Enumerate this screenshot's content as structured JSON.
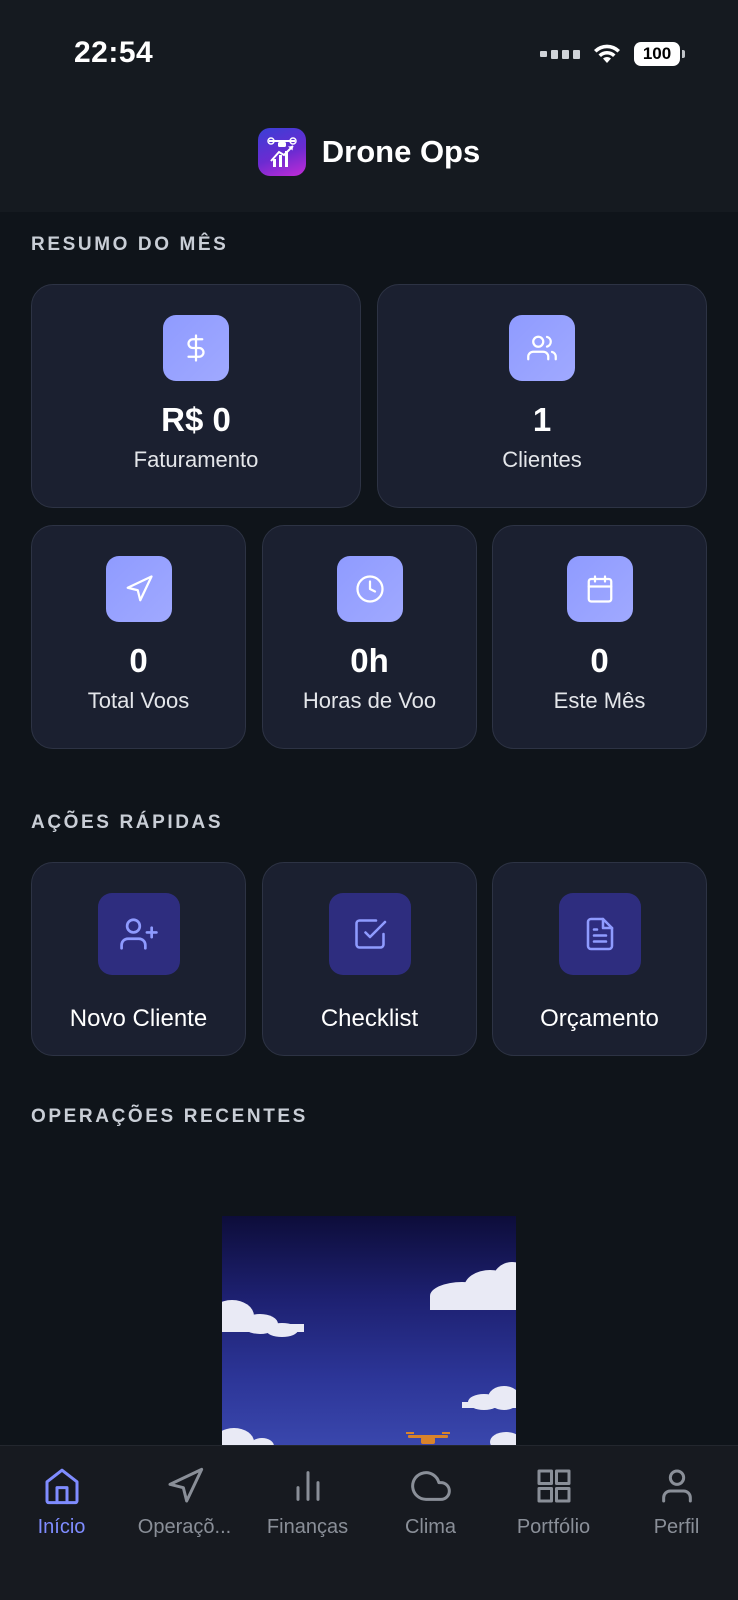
{
  "status_bar": {
    "time": "22:54",
    "battery": "100"
  },
  "header": {
    "app_title": "Drone Ops"
  },
  "summary": {
    "title": "RESUMO DO MÊS",
    "stats": [
      {
        "value": "R$ 0",
        "label": "Faturamento",
        "icon": "dollar-icon"
      },
      {
        "value": "1",
        "label": "Clientes",
        "icon": "users-icon"
      },
      {
        "value": "0",
        "label": "Total Voos",
        "icon": "navigation-icon"
      },
      {
        "value": "0h",
        "label": "Horas de Voo",
        "icon": "clock-icon"
      },
      {
        "value": "0",
        "label": "Este Mês",
        "icon": "calendar-icon"
      }
    ]
  },
  "quick_actions": {
    "title": "AÇÕES RÁPIDAS",
    "items": [
      {
        "label": "Novo Cliente",
        "icon": "user-plus-icon"
      },
      {
        "label": "Checklist",
        "icon": "checkbox-icon"
      },
      {
        "label": "Orçamento",
        "icon": "document-icon"
      }
    ]
  },
  "recent_operations": {
    "title": "OPERAÇÕES RECENTES"
  },
  "tab_bar": {
    "items": [
      {
        "label": "Início",
        "icon": "home-icon",
        "active": true
      },
      {
        "label": "Operaçõ...",
        "icon": "navigation-icon",
        "active": false
      },
      {
        "label": "Finanças",
        "icon": "bar-chart-icon",
        "active": false
      },
      {
        "label": "Clima",
        "icon": "cloud-icon",
        "active": false
      },
      {
        "label": "Portfólio",
        "icon": "grid-icon",
        "active": false
      },
      {
        "label": "Perfil",
        "icon": "user-icon",
        "active": false
      }
    ]
  },
  "colors": {
    "accent": "#7f8cff",
    "card_background": "#1b2030",
    "page_background": "#0f141a"
  }
}
